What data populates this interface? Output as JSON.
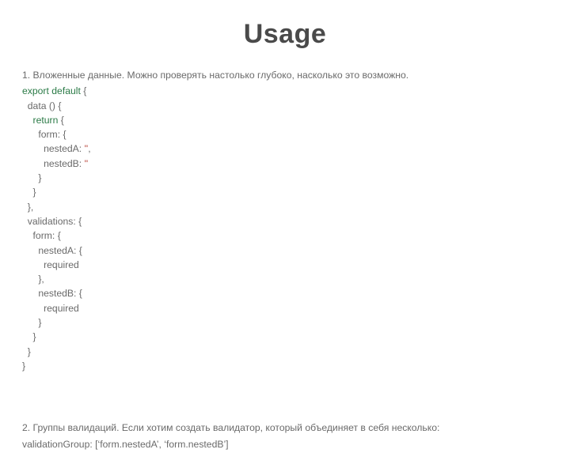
{
  "title": "Usage",
  "section1": {
    "intro": "1. Вложенные данные. Можно проверять настолько глубоко, насколько это возможно.",
    "code": {
      "l01a": "export default",
      "l01b": " {",
      "l02": "  data () {",
      "l03a": "    ",
      "l03b": "return",
      "l03c": " {",
      "l04": "      form: {",
      "l05a": "        nestedA: ",
      "l05b": "''",
      "l05c": ",",
      "l06a": "        nestedB: ",
      "l06b": "''",
      "l07": "      }",
      "l08": "    }",
      "l09": "  },",
      "l10": "  validations: {",
      "l11": "    form: {",
      "l12": "      nestedA: {",
      "l13": "        required",
      "l14": "      },",
      "l15": "      nestedB: {",
      "l16": "        required",
      "l17": "      }",
      "l18": "    }",
      "l19": "  }",
      "l20": "}"
    }
  },
  "section2": {
    "l1": "2. Группы валидаций. Если хотим создать валидатор, который объединяет в себя несколько:",
    "l2": "validationGroup: [‘form.nestedA’, ‘form.nestedB’]"
  }
}
